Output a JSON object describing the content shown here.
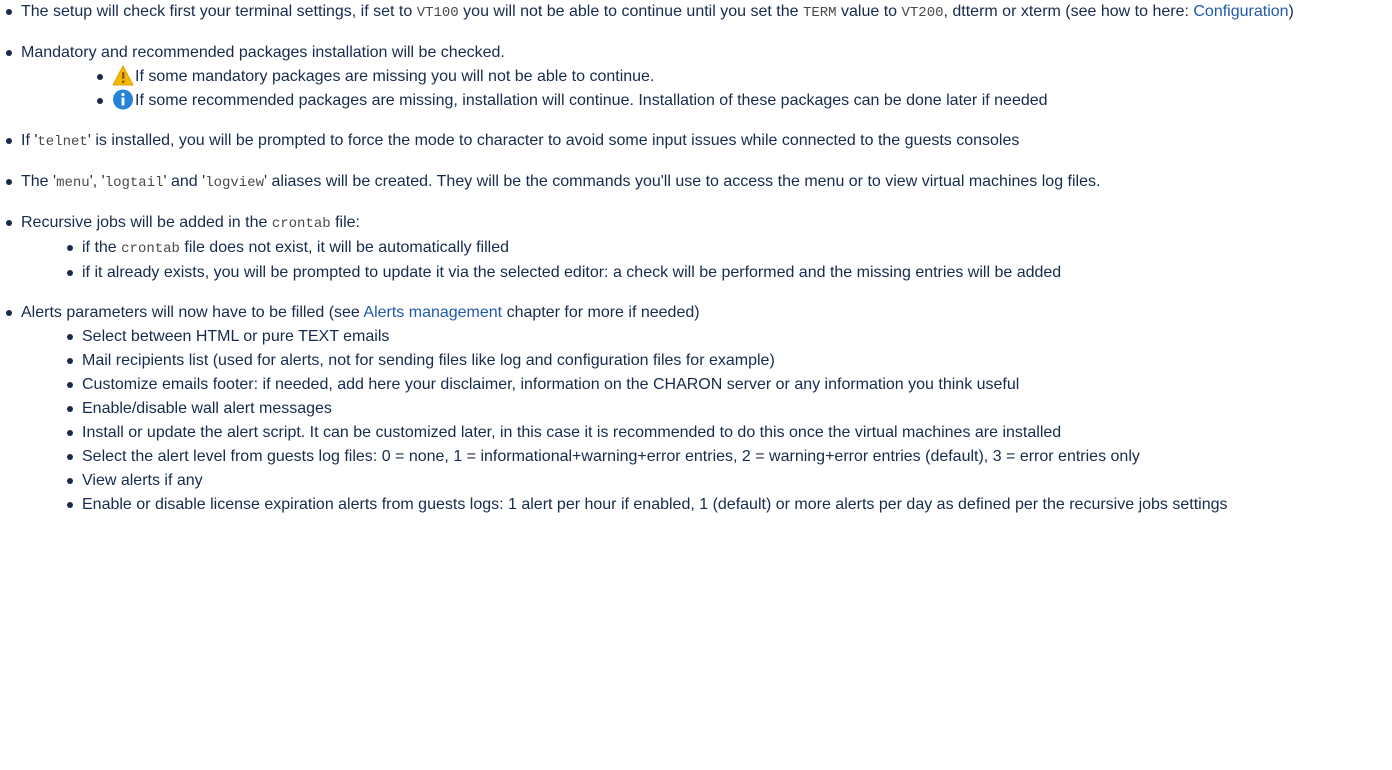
{
  "items": {
    "terminal": {
      "t1": "The setup will check first your terminal settings, if set to ",
      "c1": "VT100",
      "t2": " you will not be able to continue until you set the ",
      "c2": "TERM",
      "t3": " value to ",
      "c3": "VT200",
      "t4": ", dtterm or xterm (see how to here: ",
      "link": "Configuration",
      "t5": ")"
    },
    "packages": {
      "text": "Mandatory and recommended packages installation will be checked.",
      "warning_icon": "warning-icon",
      "warning": "If some mandatory packages are missing you will not be able to continue.",
      "info_icon": "info-icon",
      "info": "If some recommended packages are missing, installation will continue. Installation of these packages can be done later if needed"
    },
    "telnet": {
      "t1": "If '",
      "c1": "telnet",
      "t2": "' is installed, you will be prompted to force the mode to character to avoid some input issues while connected to the guests consoles"
    },
    "aliases": {
      "t1": "The '",
      "c1": "menu",
      "t2": "', '",
      "c2": "logtail",
      "t3": "' and '",
      "c3": "logview",
      "t4": "' aliases will be created. They will be the commands you'll use to access the menu or to view virtual machines log files."
    },
    "crontab": {
      "t1": "Recursive jobs will be added in the ",
      "c1": "crontab",
      "t2": " file:",
      "s1a": "if the ",
      "s1c": "crontab",
      "s1b": " file does not exist, it will be automatically filled",
      "s2": "if it already exists, you will be prompted to update it via the selected editor: a check will be performed and the missing entries will be added"
    },
    "alerts": {
      "t1": "Alerts parameters will now have to be filled (see ",
      "link": "Alerts management",
      "t2": " chapter for more if needed)",
      "subs": [
        "Select between HTML or pure TEXT emails",
        "Mail recipients list (used for alerts, not for sending files like log and configuration files for example)",
        "Customize emails footer: if needed, add here your disclaimer, information on the CHARON server or any information you think useful",
        "Enable/disable wall alert messages",
        "Install or update the alert script. It can be customized later, in this case it is recommended to do this once the virtual machines are installed",
        "Select the alert level from guests log files: 0 = none, 1 = informational+warning+error entries, 2 = warning+error entries (default), 3 = error entries only",
        "View alerts if any",
        "Enable or disable license expiration alerts from guests logs: 1 alert per hour if enabled, 1 (default) or more alerts per day as defined per the recursive jobs settings"
      ]
    }
  },
  "colors": {
    "text": "#172b4d",
    "link": "#205aad",
    "warning": "#f5b800",
    "info": "#2584d8"
  }
}
